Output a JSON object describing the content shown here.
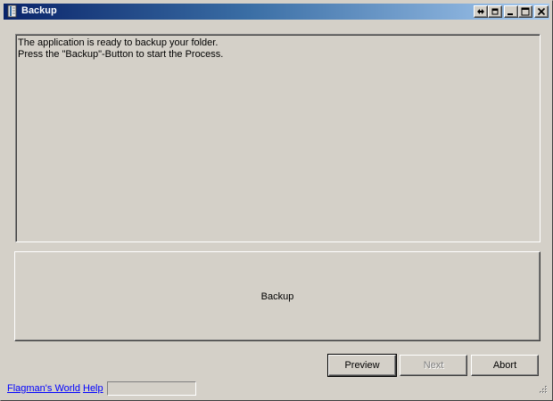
{
  "window": {
    "title": "Backup",
    "controls": [
      "pin-icon",
      "restore-small-icon",
      "minimize-icon",
      "maximize-icon",
      "close-icon"
    ]
  },
  "message": {
    "lines": [
      "The application is ready to backup your folder.",
      "Press the \"Backup\"-Button to start the Process."
    ]
  },
  "main_button": {
    "label": "Backup"
  },
  "buttons": {
    "preview": {
      "label": "Preview",
      "enabled": true
    },
    "next": {
      "label": "Next",
      "enabled": false
    },
    "abort": {
      "label": "Abort",
      "enabled": true
    }
  },
  "status_bar": {
    "links": [
      "Flagman's World",
      "Help"
    ],
    "field_value": ""
  },
  "colors": {
    "face": "#d4d0c8",
    "title_start": "#0a246a",
    "title_end": "#a6caf0",
    "link": "#0000ff",
    "disabled_text": "#808080"
  }
}
